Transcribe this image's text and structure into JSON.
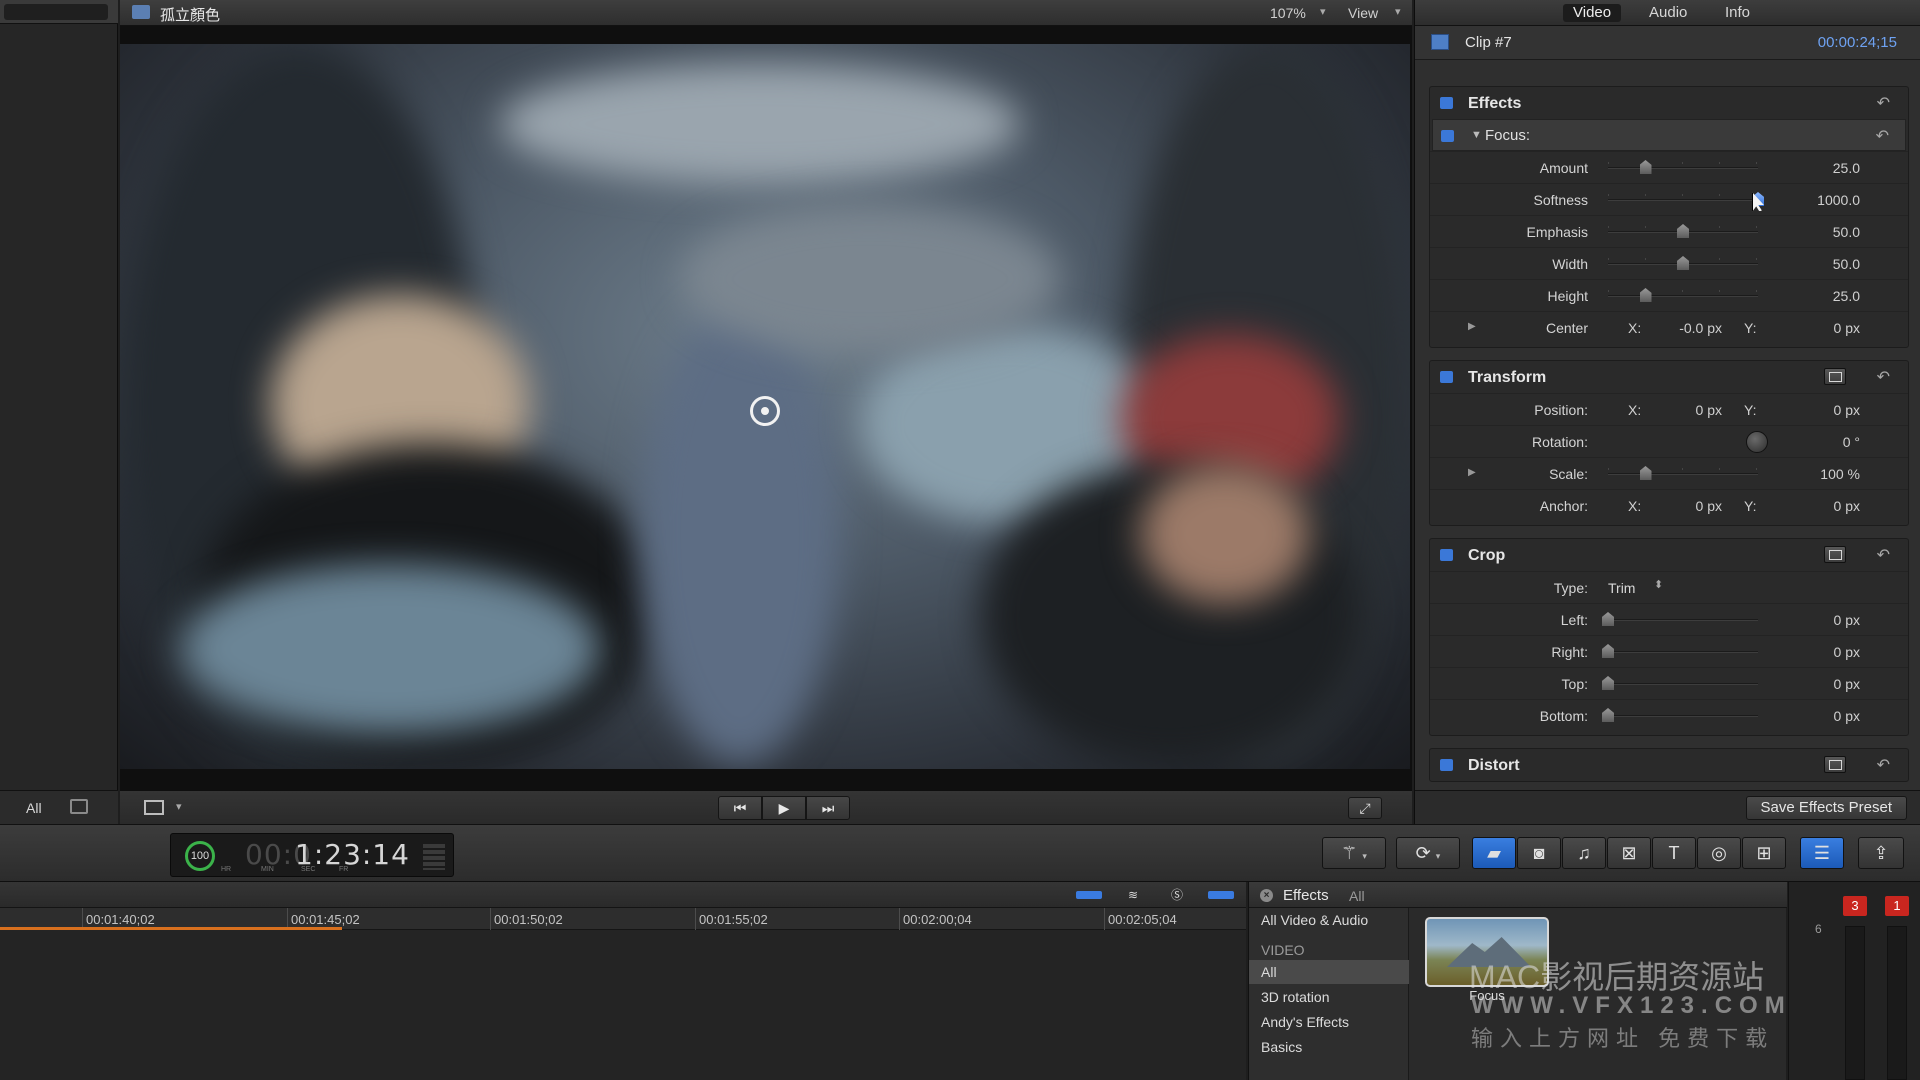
{
  "viewer": {
    "title": "孤立顏色",
    "zoom": "107%",
    "view_menu": "View",
    "transport": {
      "prev": "⏮",
      "play": "▶",
      "next": "⏭",
      "fullscreen": "⤢"
    }
  },
  "browser_left": {
    "filter_label": "All"
  },
  "inspector": {
    "tabs": [
      "Video",
      "Audio",
      "Info"
    ],
    "active_tab": "Video",
    "clip_name": "Clip #7",
    "clip_duration": "00:00:24;15",
    "reset_glyph": "↶",
    "effects": {
      "title": "Effects",
      "focus": {
        "title": "Focus:",
        "params": [
          {
            "label": "Amount",
            "value": "25.0",
            "level": 0.25
          },
          {
            "label": "Softness",
            "value": "1000.0",
            "level": 1.0
          },
          {
            "label": "Emphasis",
            "value": "50.0",
            "level": 0.5
          },
          {
            "label": "Width",
            "value": "50.0",
            "level": 0.5
          },
          {
            "label": "Height",
            "value": "25.0",
            "level": 0.25
          }
        ],
        "center": {
          "label": "Center",
          "x_label": "X:",
          "x_value": "-0.0 px",
          "y_label": "Y:",
          "y_value": "0 px"
        }
      }
    },
    "transform": {
      "title": "Transform",
      "position": {
        "label": "Position:",
        "x_label": "X:",
        "x_value": "0 px",
        "y_label": "Y:",
        "y_value": "0 px"
      },
      "rotation": {
        "label": "Rotation:",
        "value": "0 °"
      },
      "scale": {
        "label": "Scale:",
        "value": "100 %",
        "level": 0.25
      },
      "anchor": {
        "label": "Anchor:",
        "x_label": "X:",
        "x_value": "0 px",
        "y_label": "Y:",
        "y_value": "0 px"
      }
    },
    "crop": {
      "title": "Crop",
      "type": {
        "label": "Type:",
        "value": "Trim",
        "caret": "⬍"
      },
      "params": [
        {
          "label": "Left:",
          "value": "0 px",
          "level": 0
        },
        {
          "label": "Right:",
          "value": "0 px",
          "level": 0
        },
        {
          "label": "Top:",
          "value": "0 px",
          "level": 0
        },
        {
          "label": "Bottom:",
          "value": "0 px",
          "level": 0
        }
      ]
    },
    "distort": {
      "title": "Distort"
    },
    "save_preset": "Save Effects Preset"
  },
  "toolbar": {
    "speed": "100",
    "timecode_dim": "00:0",
    "timecode_bright": "1:23:14",
    "timecode_units": [
      "HR",
      "MIN",
      "SEC",
      "FR"
    ]
  },
  "timeline": {
    "ticks": [
      "00:01:40;02",
      "00:01:45;02",
      "00:01:50;02",
      "00:01:55;02",
      "00:02:00;04",
      "00:02:05;04"
    ]
  },
  "effects_browser": {
    "title": "Effects",
    "scope": "All",
    "top_item": "All Video & Audio",
    "group_label": "VIDEO",
    "items": [
      "All",
      "3D rotation",
      "Andy's Effects",
      "Basics"
    ],
    "selected": "All",
    "thumbnail_label": "Focus",
    "watermark_line1": "MAC影视后期资源站",
    "watermark_line2": "WWW.VFX123.COM",
    "watermark_line3": "输入上方网址 免费下载"
  },
  "audio_meters": {
    "peak_left": "3",
    "peak_right": "1",
    "scale_label": "6"
  },
  "colors": {
    "accent_blue": "#3b78d8",
    "timecode_blue": "#6ea2f2",
    "peak_red": "#c9261f",
    "range_orange": "#d8701e"
  }
}
